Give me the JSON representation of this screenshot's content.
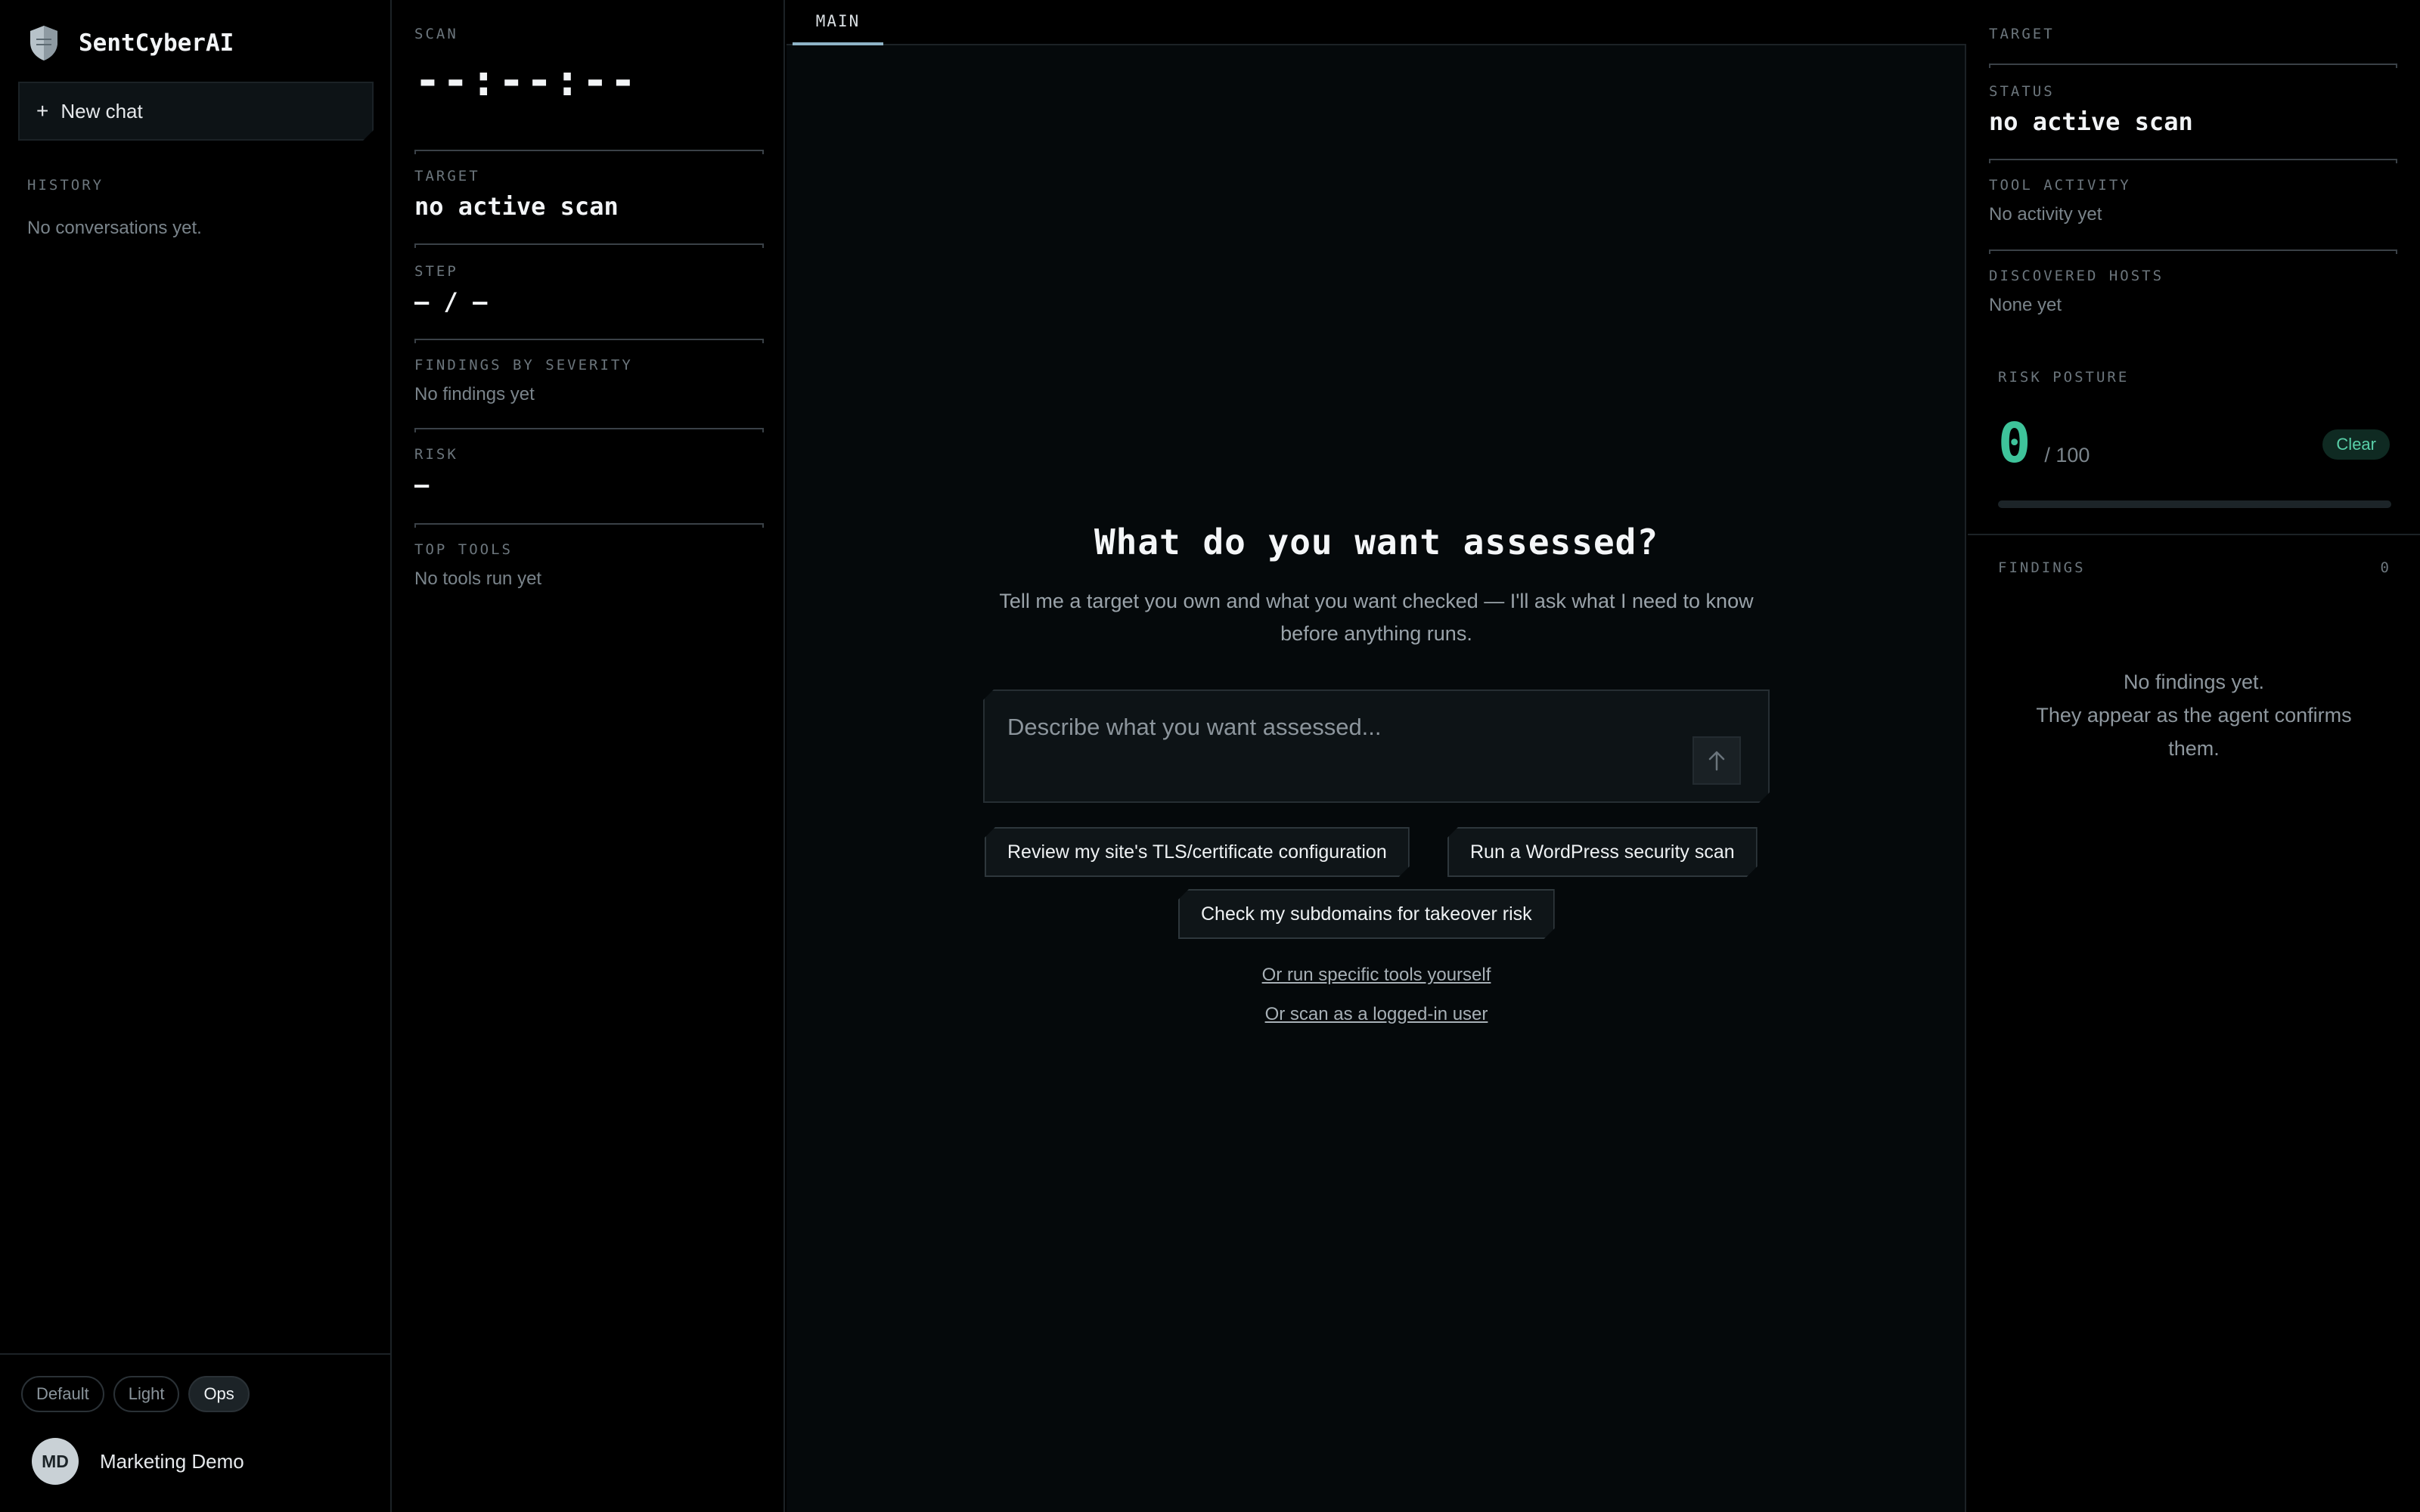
{
  "brand": {
    "name": "SentCyberAI"
  },
  "sidebar": {
    "new_chat_label": "New chat",
    "history_label": "HISTORY",
    "history_empty": "No conversations yet.",
    "themes": [
      {
        "label": "Default",
        "active": false
      },
      {
        "label": "Light",
        "active": false
      },
      {
        "label": "Ops",
        "active": true
      }
    ],
    "user": {
      "initials": "MD",
      "name": "Marketing Demo"
    }
  },
  "scan": {
    "label": "SCAN",
    "timer": "--:--:--",
    "target_label": "TARGET",
    "target_value": "no active scan",
    "step_label": "STEP",
    "step_value": "— / —",
    "findings_label": "FINDINGS BY SEVERITY",
    "findings_value": "No findings yet",
    "risk_label": "RISK",
    "risk_value": "—",
    "top_tools_label": "TOP TOOLS",
    "top_tools_value": "No tools run yet"
  },
  "main": {
    "tab_label": "MAIN",
    "title": "What do you want assessed?",
    "subtitle": "Tell me a target you own and what you want checked — I'll ask what I need to know before anything runs.",
    "input_placeholder": "Describe what you want assessed...",
    "suggestions": [
      "Review my site's TLS/certificate configuration",
      "Run a WordPress security scan",
      "Check my subdomains for takeover risk"
    ],
    "link_tools": "Or run specific tools yourself",
    "link_logged_in": "Or scan as a logged-in user"
  },
  "right": {
    "target_label": "TARGET",
    "status_label": "STATUS",
    "status_value": "no active scan",
    "tool_activity_label": "TOOL ACTIVITY",
    "tool_activity_value": "No activity yet",
    "discovered_hosts_label": "DISCOVERED HOSTS",
    "discovered_hosts_value": "None yet",
    "risk_posture_label": "RISK POSTURE",
    "risk_score": "0",
    "risk_max": "/ 100",
    "risk_fraction": 0,
    "clear_label": "Clear",
    "findings_label": "FINDINGS",
    "findings_count": "0",
    "findings_empty_line1": "No findings yet.",
    "findings_empty_line2": "They appear as the agent confirms them."
  },
  "colors": {
    "accent": "#3ec39a",
    "tab_underline": "#8fb4c7",
    "background": "#000000"
  },
  "icons": {
    "brand": "shield-icon",
    "new_chat": "plus-icon",
    "send": "arrow-up-icon"
  }
}
